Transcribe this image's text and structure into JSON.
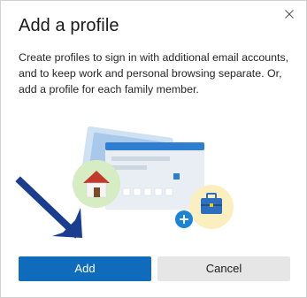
{
  "dialog": {
    "title": "Add a profile",
    "description": "Create profiles to sign in with additional email accounts, and to keep work and personal browsing separate. Or, add a profile for each family member.",
    "close_icon": "close-icon",
    "add_label": "Add",
    "cancel_label": "Cancel"
  },
  "illustration": {
    "icons": [
      "home-icon",
      "briefcase-icon",
      "plus-icon",
      "arrow-icon"
    ]
  },
  "colors": {
    "primary": "#0f6cbd",
    "arrow": "#1a3d8f",
    "home_bg": "#d6ecc2",
    "work_bg": "#fbefc0",
    "plus": "#1a84d8"
  }
}
